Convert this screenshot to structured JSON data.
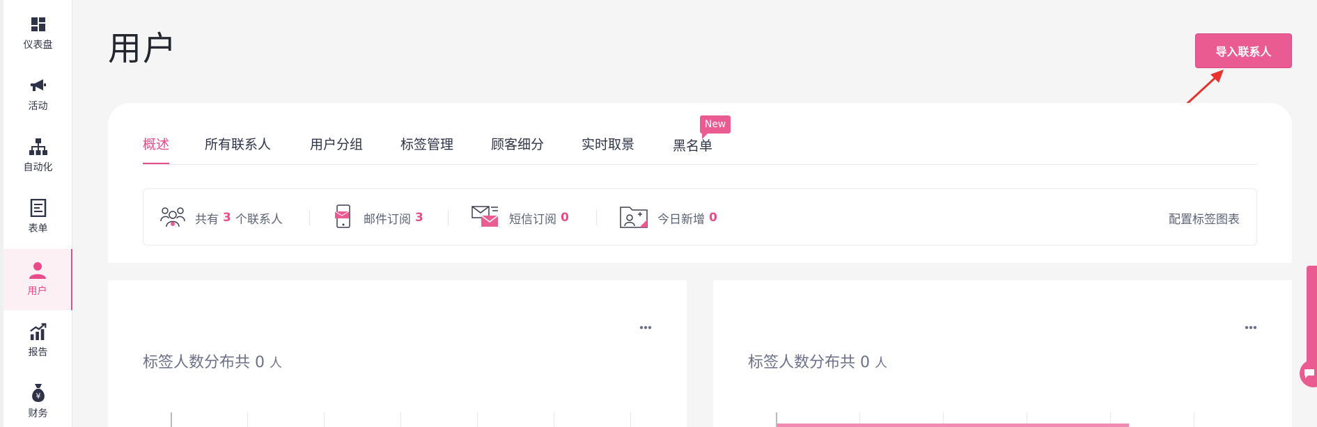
{
  "sidebar": {
    "items": [
      {
        "label": "仪表盘",
        "icon": "dashboard-icon"
      },
      {
        "label": "活动",
        "icon": "megaphone-icon"
      },
      {
        "label": "自动化",
        "icon": "flowchart-icon"
      },
      {
        "label": "表单",
        "icon": "form-icon"
      },
      {
        "label": "用户",
        "icon": "user-icon",
        "active": true
      },
      {
        "label": "报告",
        "icon": "report-chart-icon"
      },
      {
        "label": "财务",
        "icon": "money-bag-icon"
      }
    ]
  },
  "page": {
    "title": "用户",
    "import_button": "导入联系人"
  },
  "tabs": [
    {
      "label": "概述",
      "active": true
    },
    {
      "label": "所有联系人"
    },
    {
      "label": "用户分组"
    },
    {
      "label": "标签管理"
    },
    {
      "label": "顾客细分"
    },
    {
      "label": "实时取景"
    },
    {
      "label": "黑名单",
      "badge": "New"
    }
  ],
  "stats": {
    "contacts": {
      "prefix": "共有",
      "value": "3",
      "suffix": "个联系人"
    },
    "email": {
      "label": "邮件订阅",
      "value": "3"
    },
    "sms": {
      "label": "短信订阅",
      "value": "0"
    },
    "today": {
      "label": "今日新增",
      "value": "0"
    },
    "config_link": "配置标签图表"
  },
  "panels": [
    {
      "title": "标签人数分布共",
      "count": "0",
      "unit": "人"
    },
    {
      "title": "标签人数分布共",
      "count": "0",
      "unit": "人"
    }
  ],
  "colors": {
    "accent": "#ea5b91",
    "text": "#2f3348",
    "muted": "#6c7088",
    "background": "#f5f5f6"
  }
}
